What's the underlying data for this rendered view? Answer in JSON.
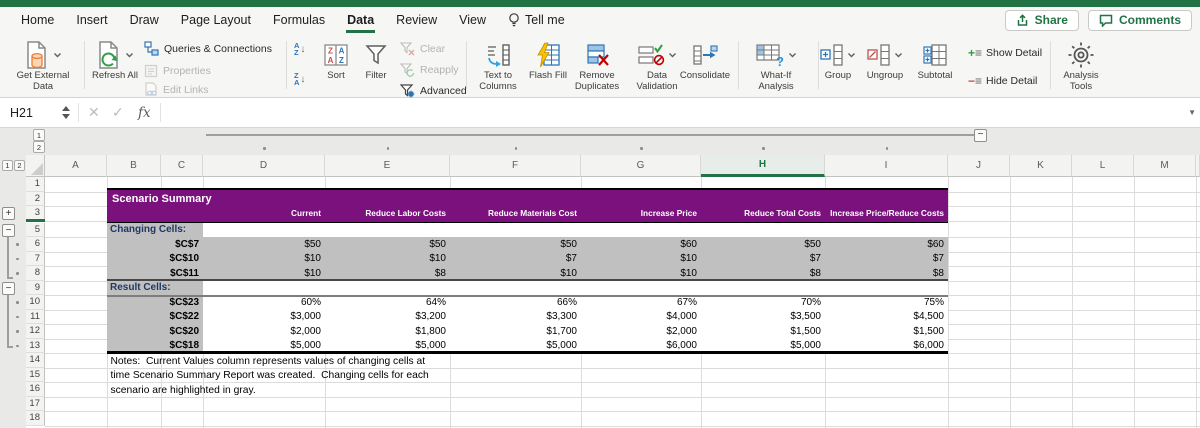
{
  "colors": {
    "accent_green": "#217346",
    "table_purple": "#7A117C",
    "table_gray": "#C0C0C0",
    "label_blue": "#1F3864"
  },
  "menu_bar": {
    "items": [
      {
        "label": "Home",
        "active": false
      },
      {
        "label": "Insert",
        "active": false
      },
      {
        "label": "Draw",
        "active": false
      },
      {
        "label": "Page Layout",
        "active": false
      },
      {
        "label": "Formulas",
        "active": false
      },
      {
        "label": "Data",
        "active": true
      },
      {
        "label": "Review",
        "active": false
      },
      {
        "label": "View",
        "active": false
      }
    ],
    "tell_me": "Tell me",
    "share": "Share",
    "comments": "Comments"
  },
  "ribbon": {
    "get_external_data": "Get External Data",
    "refresh_all": "Refresh All",
    "queries_and_connections": "Queries & Connections",
    "properties": "Properties",
    "edit_links": "Edit Links",
    "sort": "Sort",
    "filter": "Filter",
    "clear": "Clear",
    "reapply": "Reapply",
    "advanced": "Advanced",
    "text_to_columns": "Text to Columns",
    "flash_fill": "Flash Fill",
    "remove_duplicates": "Remove Duplicates",
    "data_validation": "Data Validation",
    "consolidate": "Consolidate",
    "what_if_analysis": "What-If Analysis",
    "group": "Group",
    "ungroup": "Ungroup",
    "subtotal": "Subtotal",
    "show_detail": "Show Detail",
    "hide_detail": "Hide Detail",
    "analysis_tools": "Analysis Tools"
  },
  "formula_bar": {
    "name_box": "H21",
    "fx_label": "fx"
  },
  "sheet": {
    "columns": [
      "A",
      "B",
      "C",
      "D",
      "E",
      "F",
      "G",
      "H",
      "I",
      "J",
      "K",
      "L",
      "M"
    ],
    "selected_column": "H",
    "visible_rows": [
      1,
      2,
      3,
      5,
      6,
      7,
      8,
      9,
      10,
      11,
      12,
      13,
      14,
      15,
      16,
      17,
      18
    ],
    "hidden_row_marker_after_row": 3,
    "outline": {
      "row_levels": [
        "1",
        "2"
      ],
      "col_levels": [
        "1",
        "2"
      ]
    },
    "table": {
      "title": "Scenario Summary",
      "col_headers": [
        "Current",
        "Reduce Labor Costs",
        "Reduce Materials Cost",
        "Increase Price",
        "Reduce Total Costs",
        "Increase Price/Reduce Costs"
      ],
      "sections": [
        {
          "label": "Changing Cells:",
          "rows": [
            {
              "label": "$C$7",
              "values": [
                "$50",
                "$50",
                "$50",
                "$60",
                "$50",
                "$60"
              ]
            },
            {
              "label": "$C$10",
              "values": [
                "$10",
                "$10",
                "$7",
                "$10",
                "$7",
                "$7"
              ]
            },
            {
              "label": "$C$11",
              "values": [
                "$10",
                "$8",
                "$10",
                "$10",
                "$8",
                "$8"
              ]
            }
          ]
        },
        {
          "label": "Result Cells:",
          "rows": [
            {
              "label": "$C$23",
              "values": [
                "60%",
                "64%",
                "66%",
                "67%",
                "70%",
                "75%"
              ]
            },
            {
              "label": "$C$22",
              "values": [
                "$3,000",
                "$3,200",
                "$3,300",
                "$4,000",
                "$3,500",
                "$4,500"
              ]
            },
            {
              "label": "$C$20",
              "values": [
                "$2,000",
                "$1,800",
                "$1,700",
                "$2,000",
                "$1,500",
                "$1,500"
              ]
            },
            {
              "label": "$C$18",
              "values": [
                "$5,000",
                "$5,000",
                "$5,000",
                "$6,000",
                "$5,000",
                "$6,000"
              ]
            }
          ]
        }
      ],
      "notes": [
        "Notes:  Current Values column represents values of changing cells at",
        "time Scenario Summary Report was created.  Changing cells for each",
        "scenario are highlighted in gray."
      ]
    }
  }
}
